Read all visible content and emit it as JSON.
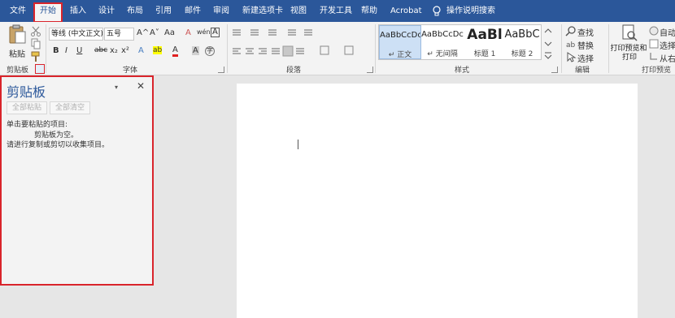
{
  "menubar": {
    "tabs": [
      "文件",
      "开始",
      "插入",
      "设计",
      "布局",
      "引用",
      "邮件",
      "审阅",
      "新建选项卡",
      "视图",
      "开发工具",
      "帮助",
      "Acrobat"
    ],
    "tell_me": "操作说明搜索",
    "active_tab": "开始",
    "bg_color": "#2b579a"
  },
  "ribbon": {
    "clipboard": {
      "paste_label": "粘贴",
      "group_label": "剪贴板"
    },
    "font": {
      "font_name": "等线 (中文正文)",
      "font_size": "五号",
      "group_label": "字体",
      "btn_bold": "B",
      "btn_italic": "I",
      "btn_underline": "U",
      "btn_strike": "abc",
      "btn_sub": "x₂",
      "btn_sup": "x²",
      "btn_grow": "A^",
      "btn_shrink": "A˅",
      "btn_case": "Aa",
      "btn_clear": "A",
      "btn_phonetic": "wén",
      "btn_border": "A",
      "btn_highlight": "ab",
      "btn_color": "A",
      "btn_shade": "A",
      "btn_circle": "字"
    },
    "paragraph": {
      "group_label": "段落"
    },
    "styles": {
      "group_label": "样式",
      "items": [
        {
          "sample": "AaBbCcDc",
          "name": "↵ 正文"
        },
        {
          "sample": "AaBbCcDc",
          "name": "↵ 无间隔"
        },
        {
          "sample": "AaBl",
          "name": "标题 1"
        },
        {
          "sample": "AaBbC",
          "name": "标题 2"
        }
      ]
    },
    "editing": {
      "find": "查找",
      "replace": "替换",
      "select": "选择",
      "group_label": "编辑"
    },
    "print_preview": {
      "label_line1": "打印预览和",
      "label_line2": "打印",
      "auto": "自动",
      "choose": "选择多",
      "from": "从右",
      "group_label": "打印预览"
    }
  },
  "clipboard_pane": {
    "title": "剪贴板",
    "paste_all": "全部粘贴",
    "clear_all": "全部清空",
    "instruction": "单击要粘贴的项目:",
    "empty_line1": "剪贴板为空。",
    "empty_line2": "请进行复制或剪切以收集项目。",
    "border_color": "#d9242b"
  }
}
